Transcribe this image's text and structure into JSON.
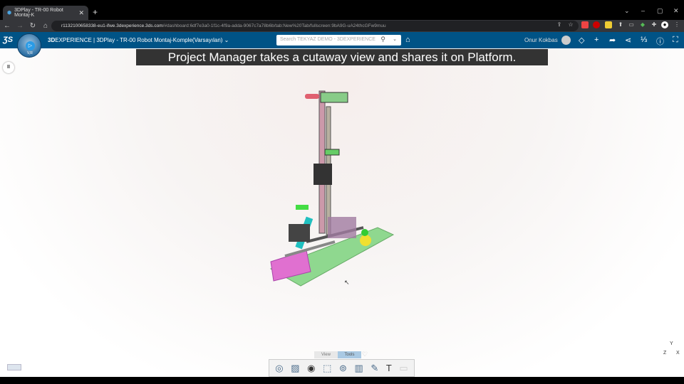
{
  "browser": {
    "tab_title": "3DPlay - TR-00 Robot Montaj-K",
    "url_host": "r1132100658338-eu1-ifwe.3dexperience.3ds.com",
    "url_rest": "/#dashboard:6df7e3a0-1f1c-4f9a-adda-9067c7a78b6b/tab:New%20Tab/fullscreen:9bA9G-uA24thcGFw9muu"
  },
  "header": {
    "brand_bold": "3D",
    "brand": "EXPERIENCE | ",
    "app_title": "3DPlay - TR-00 Robot Montaj-Komple(Varsayılan)",
    "search_placeholder": "Search TEKYAZ DEMO - 3DEXPERIENCE",
    "user_name": "Onur Kokbas",
    "compass_label": "V,R"
  },
  "caption": "Project Manager takes a cutaway view and shares it on Platform.",
  "toolbar": {
    "tabs": [
      {
        "label": "View",
        "active": false
      },
      {
        "label": "Tools",
        "active": true
      }
    ],
    "tools": [
      "snapshot-icon",
      "capture-icon",
      "visibility-icon",
      "fit-icon",
      "measure-icon",
      "section-icon",
      "pen-icon",
      "text-icon",
      "markup-icon"
    ]
  },
  "axes": {
    "y": "Y",
    "z": "Z",
    "x": "X"
  },
  "colors": {
    "header": "#005386",
    "caption_bg": "#333333"
  }
}
